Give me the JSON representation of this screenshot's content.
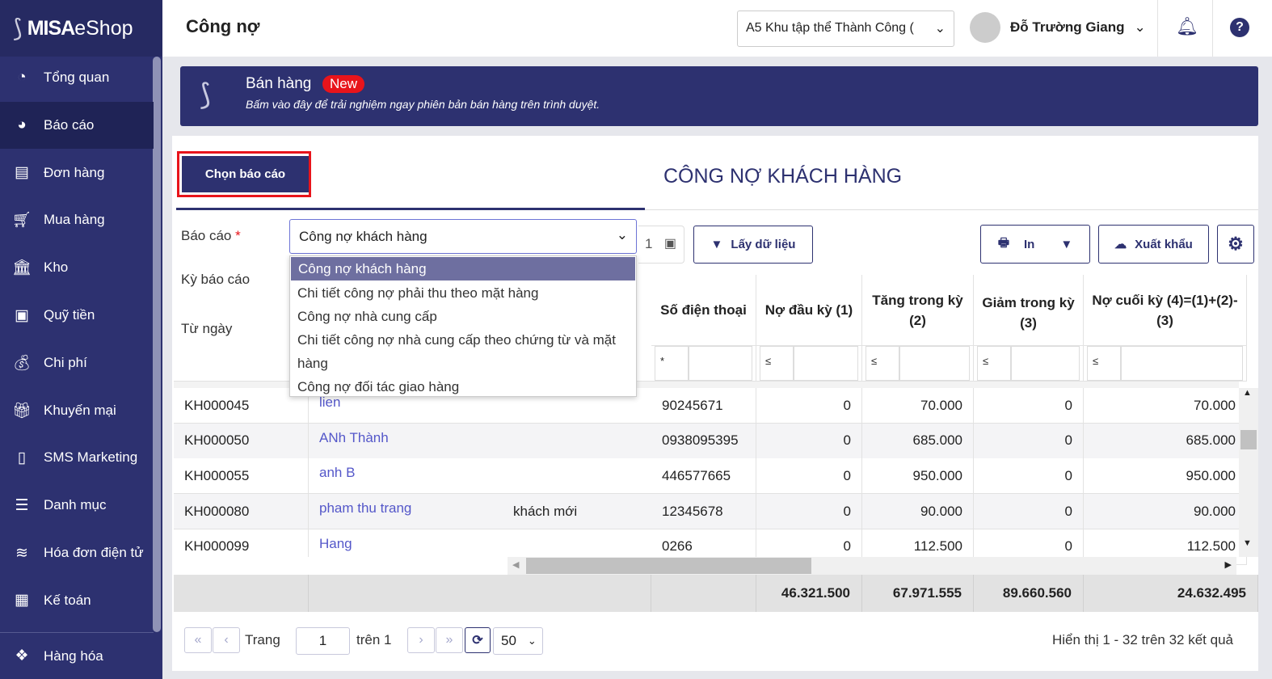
{
  "app": {
    "logo": "MISA eShop",
    "logo_bold": "MISA",
    "logo_light": "eShop"
  },
  "sidebar": {
    "items": [
      {
        "label": "Tổng quan",
        "icon": "dashboard-icon"
      },
      {
        "label": "Báo cáo",
        "icon": "pie-chart-icon",
        "active": true
      },
      {
        "label": "Đơn hàng",
        "icon": "delivery-icon"
      },
      {
        "label": "Mua hàng",
        "icon": "cart-icon"
      },
      {
        "label": "Kho",
        "icon": "warehouse-icon"
      },
      {
        "label": "Quỹ tiền",
        "icon": "safe-icon"
      },
      {
        "label": "Chi phí",
        "icon": "money-bag-icon"
      },
      {
        "label": "Khuyến mại",
        "icon": "gift-icon"
      },
      {
        "label": "SMS Marketing",
        "icon": "phone-icon"
      },
      {
        "label": "Danh mục",
        "icon": "list-icon"
      },
      {
        "label": "Hóa đơn điện tử",
        "icon": "invoice-icon"
      },
      {
        "label": "Kế toán",
        "icon": "calculator-icon"
      },
      {
        "label": "Hàng hóa",
        "icon": "boxes-icon"
      }
    ]
  },
  "header": {
    "title": "Công nợ",
    "store": "A5 Khu tập thể Thành Công (",
    "user": "Đỗ Trường Giang"
  },
  "banner": {
    "title": "Bán hàng",
    "badge": "New",
    "subtitle": "Bấm vào đây để trải nghiệm ngay phiên bản bán hàng trên trình duyệt."
  },
  "report": {
    "choose_button": "Chọn báo cáo",
    "title": "CÔNG NỢ KHÁCH HÀNG",
    "label_report": "Báo cáo",
    "required": "*",
    "label_period": "Kỳ báo cáo",
    "label_from": "Từ ngày",
    "selected": "Công nợ khách hàng",
    "options": [
      "Công nợ khách hàng",
      "Chi tiết công nợ phải thu theo mặt hàng",
      "Công nợ nhà cung cấp",
      "Chi tiết công nợ nhà cung cấp theo chứng từ và mặt hàng",
      "Công nợ đối tác giao hàng"
    ],
    "date_partial": "1",
    "fetch_button": "Lấy dữ liệu",
    "print_button": "In",
    "export_button": "Xuất khẩu"
  },
  "table": {
    "headers": [
      "Số điện thoại",
      "Nợ đầu kỳ (1)",
      "Tăng trong kỳ (2)",
      "Giảm trong kỳ (3)",
      "Nợ cuối kỳ (4)=(1)+(2)-(3)"
    ],
    "filter_ops": [
      "*",
      "≤",
      "≤",
      "≤",
      "≤"
    ],
    "rows": [
      [
        "KH000045",
        "lien",
        "",
        "90245671",
        "0",
        "70.000",
        "0",
        "70.000"
      ],
      [
        "KH000050",
        "ANh Thành",
        "",
        "0938095395",
        "0",
        "685.000",
        "0",
        "685.000"
      ],
      [
        "KH000055",
        "anh B",
        "",
        "446577665",
        "0",
        "950.000",
        "0",
        "950.000"
      ],
      [
        "KH000080",
        "pham thu trang",
        "khách mới",
        "12345678",
        "0",
        "90.000",
        "0",
        "90.000"
      ],
      [
        "KH000099",
        "Hang",
        "",
        "0266",
        "0",
        "112.500",
        "0",
        "112.500"
      ]
    ],
    "totals": [
      "46.321.500",
      "67.971.555",
      "89.660.560",
      "24.632.495"
    ]
  },
  "pagination": {
    "page_label": "Trang",
    "page": "1",
    "of_label": "trên 1",
    "page_size": "50",
    "summary": "Hiển thị 1 - 32 trên 32 kết quả"
  }
}
